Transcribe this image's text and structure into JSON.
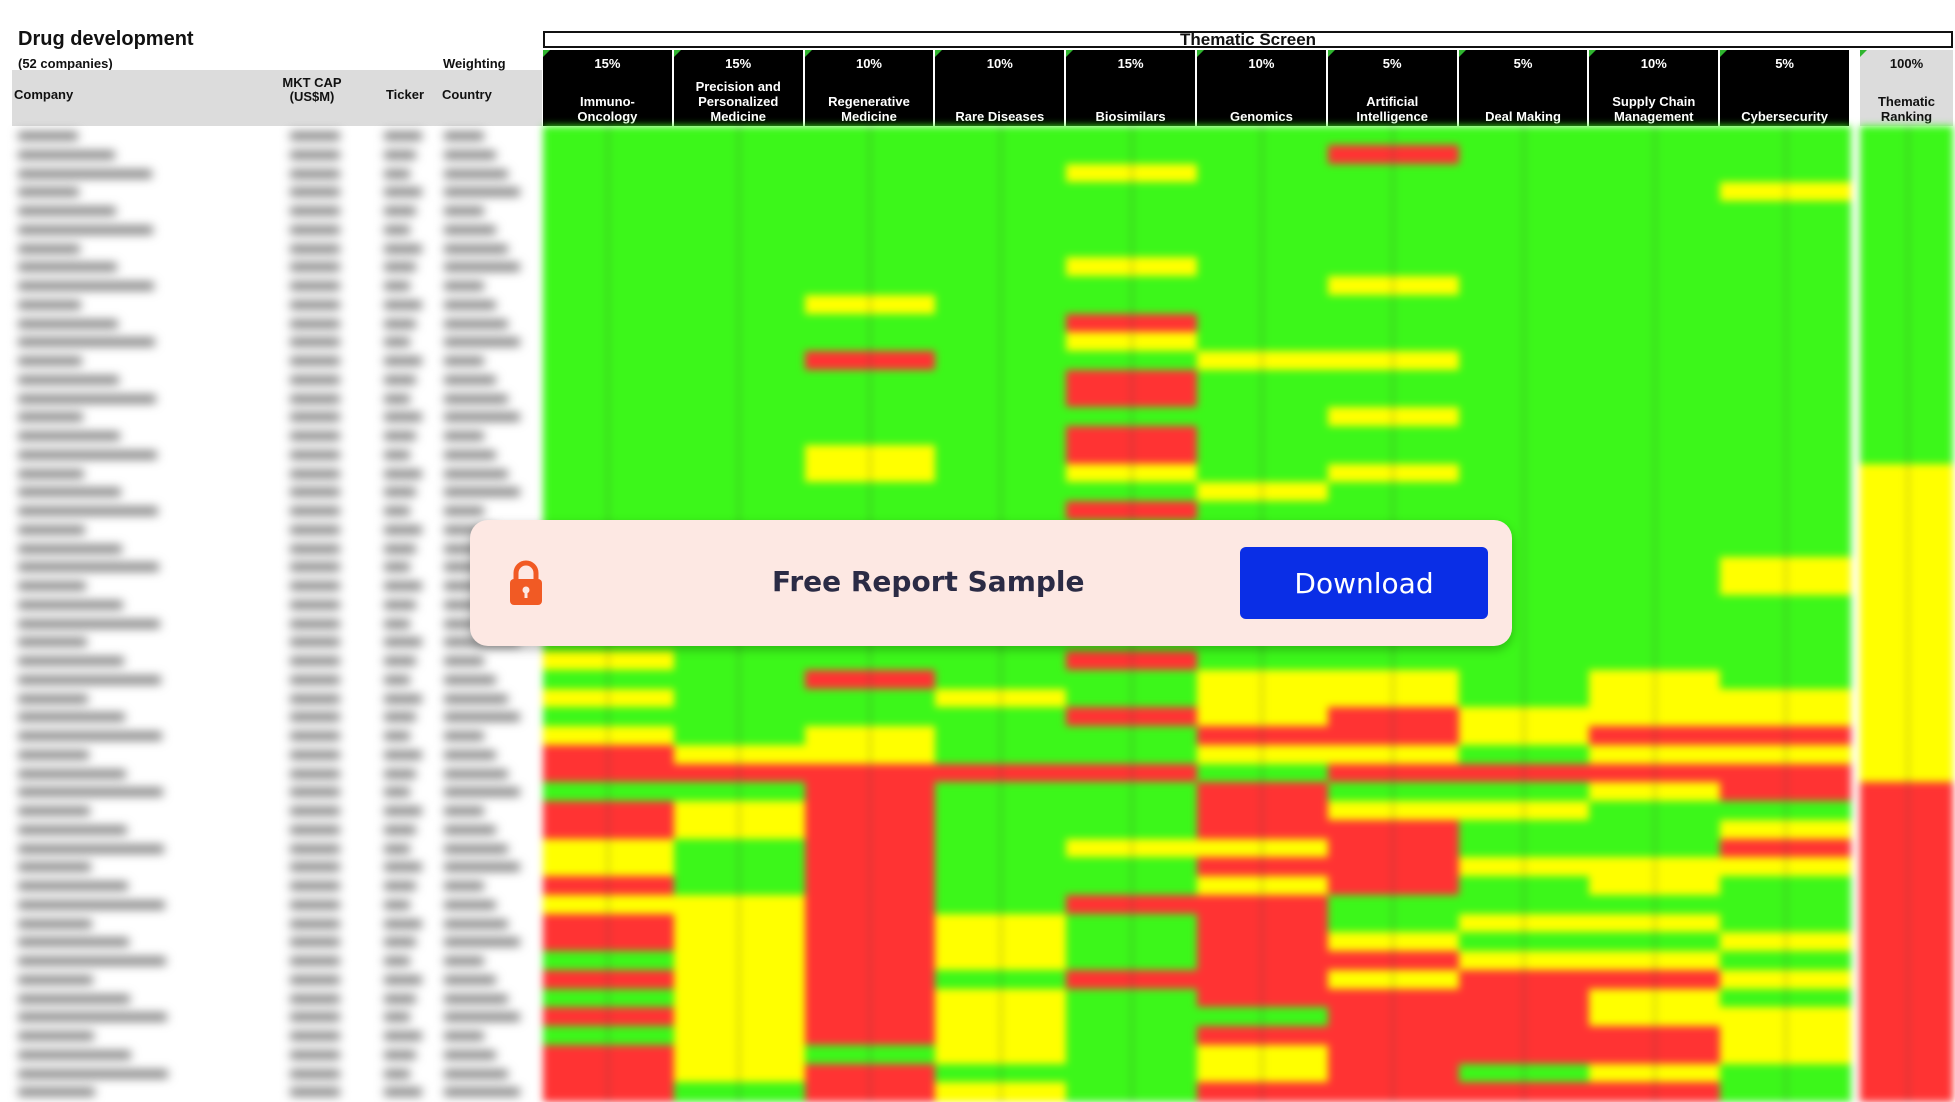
{
  "sheet": {
    "title": "Drug development",
    "subtitle": "(52 companies)",
    "weighting_label": "Weighting",
    "screen_title": "Thematic Screen",
    "columns": {
      "company": "Company",
      "mkt_cap": "MKT CAP\n(US$M)",
      "ticker": "Ticker",
      "country": "Country"
    },
    "themes": [
      {
        "name": "Immuno-\nOncology",
        "weight": "15%"
      },
      {
        "name": "Precision and\nPersonalized\nMedicine",
        "weight": "15%"
      },
      {
        "name": "Regenerative\nMedicine",
        "weight": "10%"
      },
      {
        "name": "Rare Diseases",
        "weight": "10%"
      },
      {
        "name": "Biosimilars",
        "weight": "15%"
      },
      {
        "name": "Genomics",
        "weight": "10%"
      },
      {
        "name": "Artificial\nIntelligence",
        "weight": "5%"
      },
      {
        "name": "Deal Making",
        "weight": "5%"
      },
      {
        "name": "Supply Chain\nManagement",
        "weight": "10%"
      },
      {
        "name": "Cybersecurity",
        "weight": "5%"
      }
    ],
    "ranking": {
      "name": "Thematic\nRanking",
      "weight": "100%"
    },
    "colors": {
      "green": "#3cf71a",
      "yellow": "#ffff00",
      "red": "#ff3333"
    },
    "grid_rows": [
      "GGGGGGGGGGG",
      "GGGGGGRGGGG",
      "GGGGYGGGGGG",
      "GGGGGGGGGYG",
      "GGGGGGGGGGG",
      "GGGGGGGGGGG",
      "GGGGGGGGGGG",
      "GGGGYGGGGGG",
      "GGGGGGYGGGG",
      "GGYGGGGGGGG",
      "GGGGRGGGGGG",
      "GGGGYGGGGGG",
      "GGRGGYYGGGG",
      "GGGGRGGGGGG",
      "GGGGRGGGGGG",
      "GGGGGGYGGGG",
      "GGGGRGGGGGG",
      "GGYGRGGGGGG",
      "GGYGYGYGGGY",
      "GGGGGYGGGGY",
      "GGGGRGGGGGY",
      "GGGGGGGGGGY",
      "GGGGGGGGGGY",
      "GGGGGGGGGYY",
      "GGGGGGGGGYY",
      "GGGGGGGGGGY",
      "GGGGGGGGGGY",
      "GGGGGGGGGGY",
      "YGGGRGGGGGY",
      "GGRGGYYGYGY",
      "YGGYGYYGYYY",
      "GGGGRYRYYYY",
      "YGYGGRRYRRY",
      "RYYGGYYGYYY",
      "RRRRRGRRRRY",
      "GGRGGRGGYRR",
      "RYRGGRYYGGR",
      "RYRGGRRGGYR",
      "YGRGYYRGGRR",
      "YGRGGRRYYYR",
      "RGRGGYRGYGR",
      "YYRGRRGGGGR",
      "RYRYGRGYYGR",
      "RYRYGRYGGYR",
      "GYRYGRRYYGR",
      "RYRGRRYRRYR",
      "GYRYGRRRYGR",
      "RYRYGGRRYYR",
      "GYRYGRRRRYR",
      "RYGYGYRRRYR",
      "RYRGGYRGYGR",
      "RGRYGRRRRGR"
    ],
    "banner": {
      "message": "Free Report Sample",
      "button_label": "Download",
      "accent": "#0a2ee6",
      "lock_color": "#f15a24"
    }
  }
}
